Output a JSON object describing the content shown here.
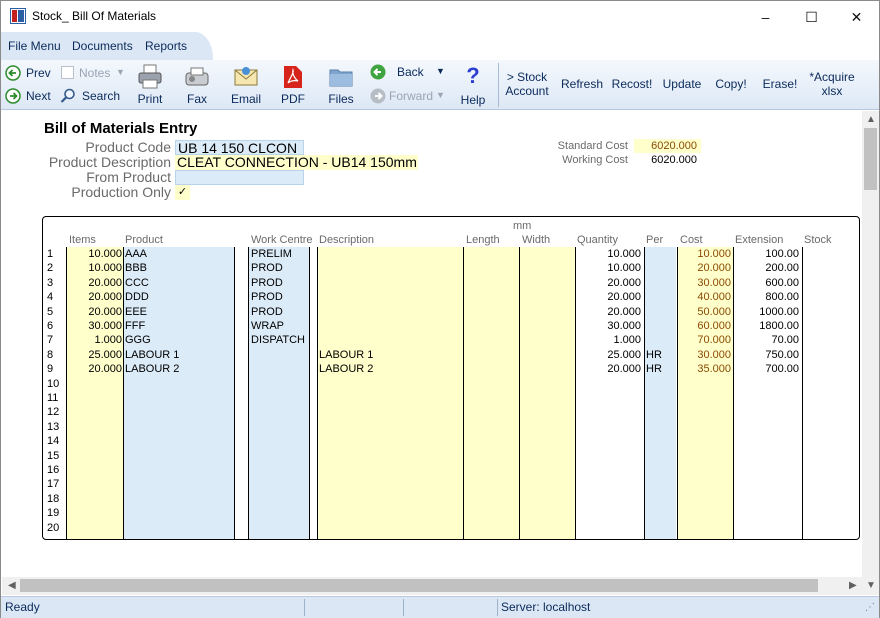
{
  "window": {
    "title": "Stock_ Bill Of Materials",
    "minimize": "–",
    "maximize": "☐",
    "close": "✕"
  },
  "menu": {
    "file": "File Menu",
    "documents": "Documents",
    "reports": "Reports"
  },
  "toolbar": {
    "prev": "Prev",
    "next": "Next",
    "notes": "Notes",
    "search": "Search",
    "print": "Print",
    "fax": "Fax",
    "email": "Email",
    "pdf": "PDF",
    "files": "Files",
    "back": "Back",
    "forward": "Forward",
    "help": "Help",
    "stock_account_1": "> Stock",
    "stock_account_2": "Account",
    "refresh": "Refresh",
    "recost": "Recost!",
    "update": "Update",
    "copy": "Copy!",
    "erase": "Erase!",
    "acquire_1": "*Acquire",
    "acquire_2": "xlsx"
  },
  "form": {
    "title": "Bill of Materials Entry",
    "product_code_label": "Product Code",
    "product_code": "UB 14 150  CLCON",
    "product_description_label": "Product Description",
    "product_description": "CLEAT CONNECTION - UB14 150mm",
    "from_product_label": "From Product",
    "from_product": "",
    "production_only_label": "Production Only",
    "production_only": "✓",
    "standard_cost_label": "Standard Cost",
    "standard_cost": "6020.000",
    "working_cost_label": "Working Cost",
    "working_cost": "6020.000"
  },
  "grid": {
    "unit_header": "mm",
    "headers": {
      "items": "Items",
      "product": "Product",
      "work_centre": "Work Centre",
      "description": "Description",
      "length": "Length",
      "width": "Width",
      "quantity": "Quantity",
      "per": "Per",
      "cost": "Cost",
      "extension": "Extension",
      "stock": "Stock"
    },
    "rows": [
      {
        "n": "1",
        "items": "10.000",
        "product": "AAA",
        "wc": "PRELIM",
        "desc": "",
        "qty": "10.000",
        "per": "",
        "cost": "10.000",
        "ext": "100.00"
      },
      {
        "n": "2",
        "items": "10.000",
        "product": "BBB",
        "wc": "PROD",
        "desc": "",
        "qty": "10.000",
        "per": "",
        "cost": "20.000",
        "ext": "200.00"
      },
      {
        "n": "3",
        "items": "20.000",
        "product": "CCC",
        "wc": "PROD",
        "desc": "",
        "qty": "20.000",
        "per": "",
        "cost": "30.000",
        "ext": "600.00"
      },
      {
        "n": "4",
        "items": "20.000",
        "product": "DDD",
        "wc": "PROD",
        "desc": "",
        "qty": "20.000",
        "per": "",
        "cost": "40.000",
        "ext": "800.00"
      },
      {
        "n": "5",
        "items": "20.000",
        "product": "EEE",
        "wc": "PROD",
        "desc": "",
        "qty": "20.000",
        "per": "",
        "cost": "50.000",
        "ext": "1000.00"
      },
      {
        "n": "6",
        "items": "30.000",
        "product": "FFF",
        "wc": "WRAP",
        "desc": "",
        "qty": "30.000",
        "per": "",
        "cost": "60.000",
        "ext": "1800.00"
      },
      {
        "n": "7",
        "items": "1.000",
        "product": "GGG",
        "wc": "DISPATCH",
        "desc": "",
        "qty": "1.000",
        "per": "",
        "cost": "70.000",
        "ext": "70.00"
      },
      {
        "n": "8",
        "items": "25.000",
        "product": "LABOUR 1",
        "wc": "",
        "desc": "LABOUR 1",
        "qty": "25.000",
        "per": "HR",
        "cost": "30.000",
        "ext": "750.00"
      },
      {
        "n": "9",
        "items": "20.000",
        "product": "LABOUR 2",
        "wc": "",
        "desc": "LABOUR 2",
        "qty": "20.000",
        "per": "HR",
        "cost": "35.000",
        "ext": "700.00"
      },
      {
        "n": "10"
      },
      {
        "n": "11"
      },
      {
        "n": "12"
      },
      {
        "n": "13"
      },
      {
        "n": "14"
      },
      {
        "n": "15"
      },
      {
        "n": "16"
      },
      {
        "n": "17"
      },
      {
        "n": "18"
      },
      {
        "n": "19"
      },
      {
        "n": "20"
      }
    ]
  },
  "status": {
    "ready": "Ready",
    "server": "Server: localhost"
  },
  "colors": {
    "blue_field": "#dcebf8",
    "yellow_field": "#ffffcc",
    "accent": "#0a2a5a",
    "cost_text": "#8b4a00"
  }
}
